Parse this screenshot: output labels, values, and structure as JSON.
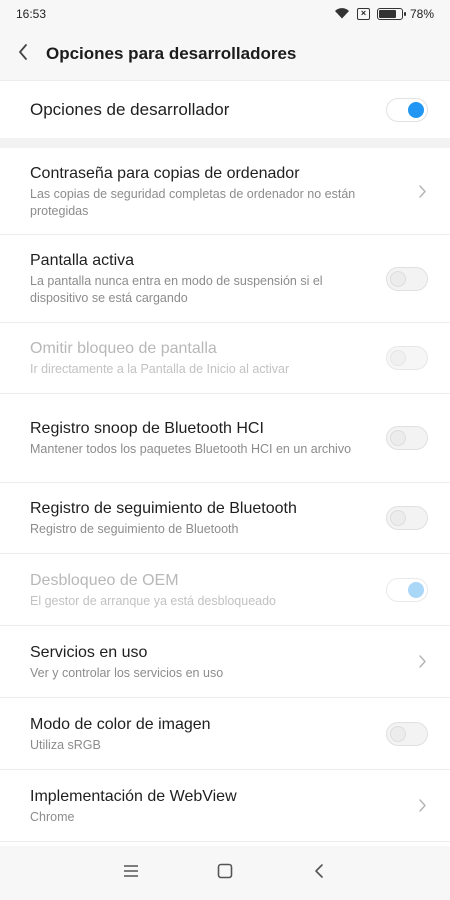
{
  "status_bar": {
    "time": "16:53",
    "battery": "78%",
    "battery_level": 0.78
  },
  "header": {
    "title": "Opciones para desarrolladores"
  },
  "master_toggle": {
    "label": "Opciones de desarrollador",
    "on": true
  },
  "settings": [
    {
      "title": "Contraseña para copias de ordenador",
      "subtitle": "Las copias de seguridad completas de ordenador no están protegidas",
      "control": "chevron",
      "disabled": false
    },
    {
      "title": "Pantalla activa",
      "subtitle": "La pantalla nunca entra en modo de suspensión si el dispositivo se está cargando",
      "control": "toggle",
      "on": false,
      "disabled": false
    },
    {
      "title": "Omitir bloqueo de pantalla",
      "subtitle": "Ir directamente a la Pantalla de Inicio al activar",
      "control": "toggle",
      "on": false,
      "disabled": true
    },
    {
      "title": "Registro snoop de Bluetooth HCI",
      "subtitle": "Mantener todos los paquetes Bluetooth HCI en un archivo",
      "control": "toggle",
      "on": false,
      "disabled": false
    },
    {
      "title": "Registro de seguimiento de Bluetooth",
      "subtitle": "Registro de seguimiento de Bluetooth",
      "control": "toggle",
      "on": false,
      "disabled": false
    },
    {
      "title": "Desbloqueo de OEM",
      "subtitle": "El gestor de arranque ya está desbloqueado",
      "control": "toggle",
      "on": true,
      "disabled": true
    },
    {
      "title": "Servicios en uso",
      "subtitle": "Ver y controlar los servicios en uso",
      "control": "chevron",
      "disabled": false
    },
    {
      "title": "Modo de color de imagen",
      "subtitle": "Utiliza sRGB",
      "control": "toggle",
      "on": false,
      "disabled": false
    },
    {
      "title": "Implementación de WebView",
      "subtitle": "Chrome",
      "control": "chevron",
      "disabled": false
    }
  ],
  "icons": {
    "back": "chevron-left-icon",
    "row_chevron": "chevron-right-icon",
    "nav_menu": "menu-icon",
    "nav_home": "home-square-icon",
    "nav_back": "back-triangle-icon"
  },
  "colors": {
    "accent": "#2196f3",
    "accent_faded": "#8ec9f6",
    "background": "#f7f7f7",
    "card": "#ffffff",
    "subtitle": "#8c8c8c",
    "disabled_text": "#b8b8b8"
  }
}
